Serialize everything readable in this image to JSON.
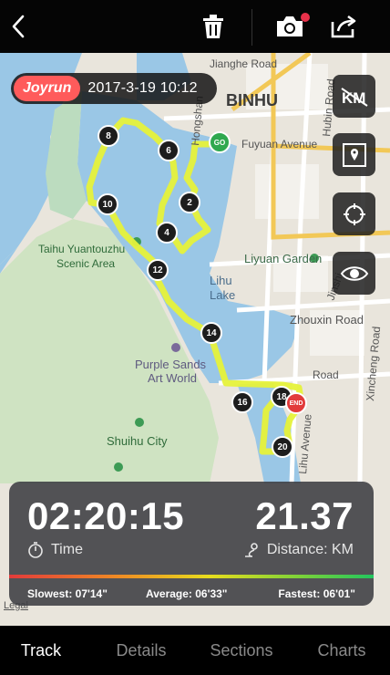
{
  "header": {
    "back_icon": "chevron-left-icon",
    "trash_icon": "trash-icon",
    "camera_icon": "camera-icon",
    "share_icon": "share-icon"
  },
  "map": {
    "brand": "Joyrun",
    "datetime": "2017-3-19 10:12",
    "labels": {
      "binhu": "BINHU",
      "jianghe": "Jianghe Road",
      "fuyuan": "Fuyuan Avenue",
      "hubin": "Hubin Road",
      "taihu": "Taihu Yuantouzhu",
      "scenic": "Scenic Area",
      "liyuan": "Liyuan Garden",
      "lihu1": "Lihu",
      "lihu2": "Lake",
      "zhouxin": "Zhouxin Road",
      "purple1": "Purple Sands",
      "purple2": "Art World",
      "shuihu": "Shuihu City",
      "jinshi": "Jinshi",
      "xincheng": "Xincheng Road",
      "hongshan": "Hongshan",
      "lihu_ave": "Lihu Avenue",
      "dong_road": "Road"
    },
    "markers": {
      "go": "GO",
      "m2": "2",
      "m4": "4",
      "m6": "6",
      "m8": "8",
      "m10": "10",
      "m12": "12",
      "m14": "14",
      "m16": "16",
      "m18": "18",
      "m20": "20",
      "end": "END"
    },
    "side_buttons": [
      "km-off-icon",
      "map-pin-icon",
      "locate-icon",
      "eye-icon"
    ],
    "legal": "Legal"
  },
  "stats": {
    "time_value": "02:20:15",
    "time_label": "Time",
    "distance_value": "21.37",
    "distance_label": "Distance: KM",
    "slowest": "Slowest: 07'14\"",
    "average": "Average: 06'33\"",
    "fastest": "Fastest: 06'01\""
  },
  "tabs": [
    "Track",
    "Details",
    "Sections",
    "Charts"
  ],
  "colors": {
    "track": "#e6f23a",
    "go": "#2fa84f",
    "end": "#e23b3b",
    "joyrun": "#ff5b5b"
  }
}
